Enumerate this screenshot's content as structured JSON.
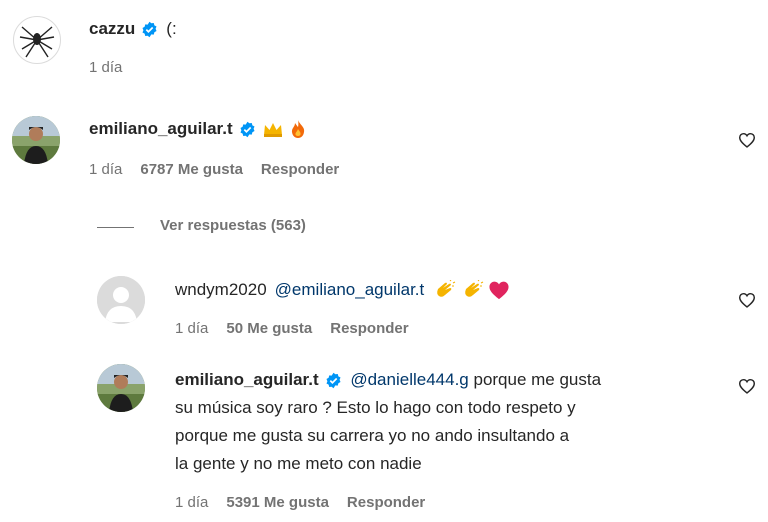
{
  "comments": [
    {
      "username": "cazzu",
      "text": "(:",
      "time": "1 día"
    },
    {
      "username": "emiliano_aguilar.t",
      "emojis": [
        "crown-emoji",
        "fire-emoji"
      ],
      "time": "1 día",
      "likes": "6787 Me gusta",
      "reply": "Responder",
      "view_replies": "Ver respuestas (563)"
    },
    {
      "username": "wndym2020",
      "mention": "@emiliano_aguilar.t",
      "emojis": [
        "clap-emoji",
        "clap-emoji",
        "red-heart-emoji"
      ],
      "time": "1 día",
      "likes": "50 Me gusta",
      "reply": "Responder"
    },
    {
      "username": "emiliano_aguilar.t",
      "mention": "@danielle444.g",
      "text_line1": "porque me gusta",
      "text_line2": "su música soy raro ? Esto lo hago con todo respeto y",
      "text_line3": "porque me gusta su carrera yo no ando insultando a",
      "text_line4": "la gente y no me meto con nadie",
      "time": "1 día",
      "likes": "5391 Me gusta",
      "reply": "Responder"
    }
  ],
  "colors": {
    "verified": "#0095f6",
    "muted": "#737373",
    "text": "#262626",
    "mention": "#00376b"
  }
}
